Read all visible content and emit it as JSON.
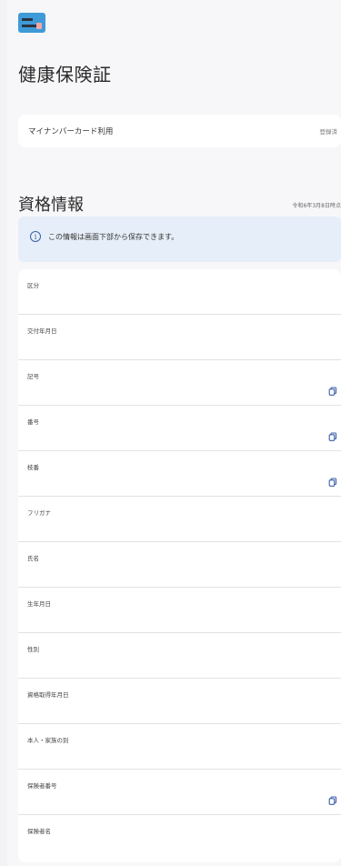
{
  "header": {
    "icon": "insurance-card-icon",
    "title": "健康保険証"
  },
  "mynumber": {
    "label": "マイナンバーカード利用",
    "status": "登録済"
  },
  "section": {
    "title": "資格情報",
    "date": "令和6年3月8日時点"
  },
  "banner": {
    "icon": "info-icon",
    "glyph": "i",
    "text": "この情報は画面下部から保存できます。"
  },
  "fields": [
    {
      "label": "区分"
    },
    {
      "label": "交付年月日"
    },
    {
      "label": "記号",
      "copy": true
    },
    {
      "label": "番号",
      "copy": true
    },
    {
      "label": "枝番",
      "copy": true
    },
    {
      "label": "フリガナ"
    },
    {
      "label": "氏名"
    },
    {
      "label": "生年月日"
    },
    {
      "label": "性別"
    },
    {
      "label": "資格取得年月日"
    },
    {
      "label": "本人・家族の別"
    },
    {
      "label": "保険者番号",
      "copy": true
    },
    {
      "label": "保険者名"
    }
  ],
  "colors": {
    "accent": "#3a5ea8",
    "banner_bg": "#e6eff9",
    "card_icon": "#3f9ad8"
  }
}
